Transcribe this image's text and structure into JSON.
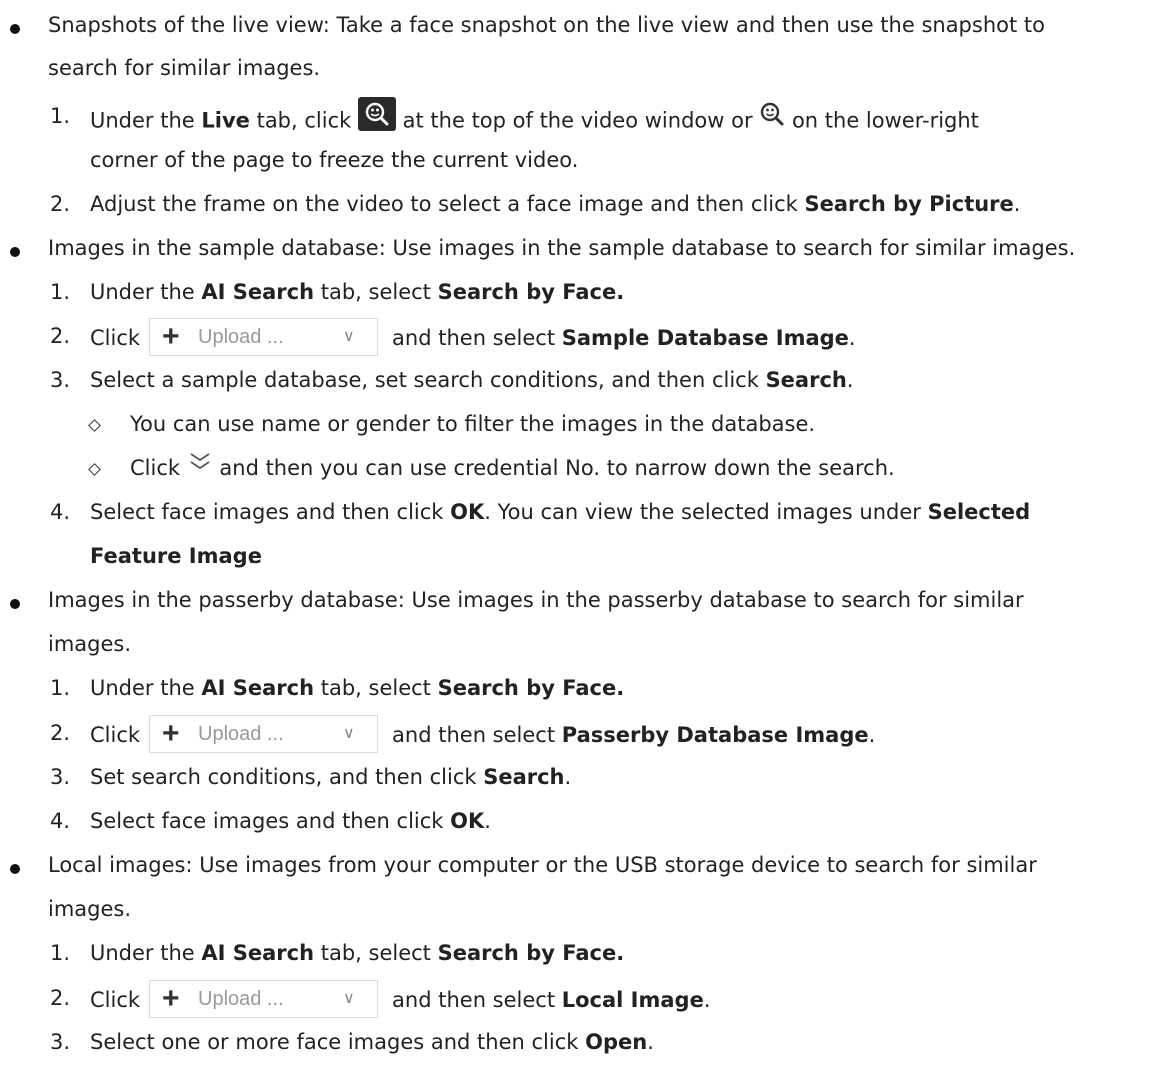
{
  "bullets": [
    {
      "text": "Snapshots of the live view: Take a face snapshot on the live view and then use the snapshot to",
      "cont": "search for similar images."
    },
    {
      "text": "Images in the sample database: Use images in the sample database to search for similar images."
    },
    {
      "text": "Images in the passerby database: Use images in the passerby database to search for similar",
      "cont": "images."
    },
    {
      "text": "Local images: Use images from your computer or the USB storage device to search for similar",
      "cont": "images."
    }
  ],
  "s1": {
    "n1": "1.",
    "a": "Under the ",
    "live": "Live",
    "b": " tab, click ",
    "c": " at the top of the video window or ",
    "d": " on the lower-right",
    "cont": "corner of the page to freeze the current video.",
    "n2": "2.",
    "e": "Adjust the frame on the video to select a face image and then click ",
    "f": "Search by Picture",
    "g": "."
  },
  "common": {
    "under": "Under the ",
    "ai_search": "AI Search",
    "tab_select": " tab, select ",
    "search_by_face": "Search by Face.",
    "click": "Click",
    "then_select": "and then select ",
    "upload_label": "Upload ...",
    "period": "."
  },
  "s2": {
    "n1": "1.",
    "n2": "2.",
    "sample_db_image": "Sample Database Image",
    "n3": "3.",
    "s3a": "Select a sample database, set search conditions, and then click ",
    "search": "Search",
    "s3b": ".",
    "sub1": "You can use name or gender to filter the images in the database.",
    "sub2a": "Click ",
    "sub2b": " and then you can use credential No. to narrow down the search.",
    "n4": "4.",
    "s4a": "Select face images and then click ",
    "ok": "OK",
    "s4b": ". You can view the selected images under ",
    "sel1": "Selected",
    "sel2": "Feature Image",
    "s4c": "."
  },
  "s3": {
    "n1": "1.",
    "n2": "2.",
    "passerby_db_image": "Passerby Database Image",
    "n3": "3.",
    "s3a": "Set search conditions, and then click ",
    "search": "Search",
    "s3b": ".",
    "n4": "4.",
    "s4a": "Select face images and then click ",
    "ok": "OK",
    "s4b": "."
  },
  "s4": {
    "n1": "1.",
    "n2": "2.",
    "local_image": "Local Image",
    "n3": "3.",
    "s3a": "Select one or more face images and then click ",
    "open": "Open",
    "s3b": "."
  },
  "icons": {
    "snapshot_dark": "snapshot-search-icon-dark",
    "snapshot_plain": "snapshot-search-icon",
    "expand": "double-chevron-down-icon",
    "plus": "plus-icon",
    "chevron": "chevron-down-icon"
  },
  "colors": {
    "text": "#222222",
    "upload_text": "#999999",
    "upload_border": "#dcdcdc",
    "icon_dark_bg": "#2a2a2a"
  }
}
